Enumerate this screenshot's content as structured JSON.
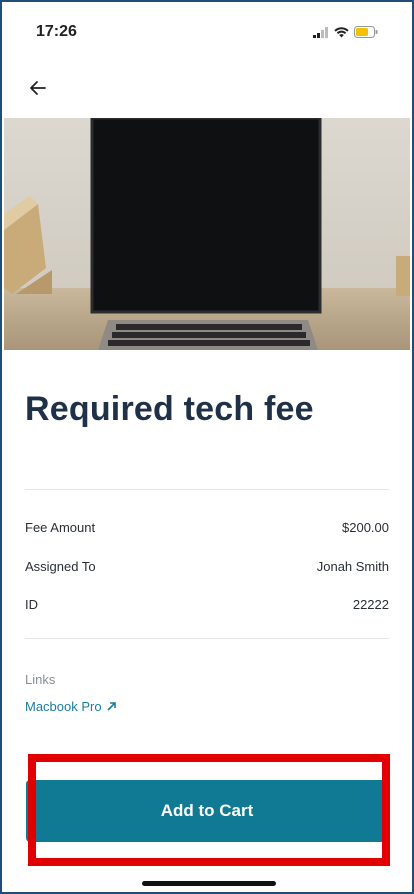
{
  "status_bar": {
    "time": "17:26"
  },
  "header": {
    "back_icon": "arrow-left-icon"
  },
  "hero_image": {
    "subject": "laptop-photo"
  },
  "title": "Required tech fee",
  "details": [
    {
      "label": "Fee Amount",
      "value": "$200.00"
    },
    {
      "label": "Assigned To",
      "value": "Jonah Smith"
    },
    {
      "label": "ID",
      "value": "22222"
    }
  ],
  "links": {
    "label": "Links",
    "items": [
      {
        "text": "Macbook Pro",
        "icon": "external-link-icon"
      }
    ]
  },
  "actions": {
    "add_to_cart_label": "Add to Cart"
  },
  "colors": {
    "primary": "#107a95",
    "title": "#1f3148",
    "link": "#1b7ea0",
    "highlight": "#e00000"
  }
}
